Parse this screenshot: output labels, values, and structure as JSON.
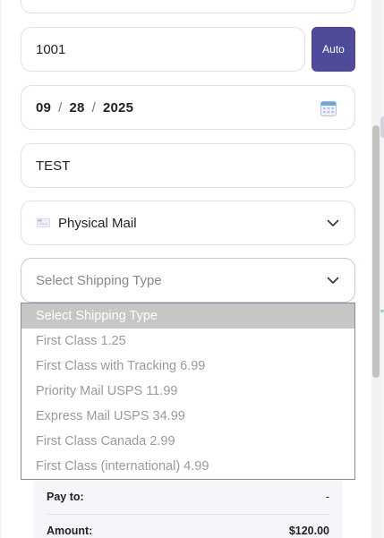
{
  "form": {
    "invoice_number": "1001",
    "auto_label": "Auto",
    "date": {
      "month": "09",
      "day": "28",
      "year": "2025",
      "sep": "/"
    },
    "description": "TEST",
    "delivery_method": "Physical Mail",
    "shipping_placeholder": "Select Shipping Type"
  },
  "shipping_options": [
    "Select Shipping Type",
    "First Class 1.25",
    "First Class with Tracking 6.99",
    "Priority Mail USPS 11.99",
    "Express Mail USPS 34.99",
    "First Class Canada 2.99",
    "First Class (international) 4.99"
  ],
  "summary": {
    "pay_to_label": "Pay to:",
    "pay_to_value": "-",
    "amount_label": "Amount:",
    "amount_value": "$120.00"
  },
  "colors": {
    "accent": "#4f4a9a",
    "selected_option_bg": "#c6c6c6"
  },
  "icons": [
    "calendar-icon",
    "mail-icon",
    "chevron-down-icon"
  ]
}
